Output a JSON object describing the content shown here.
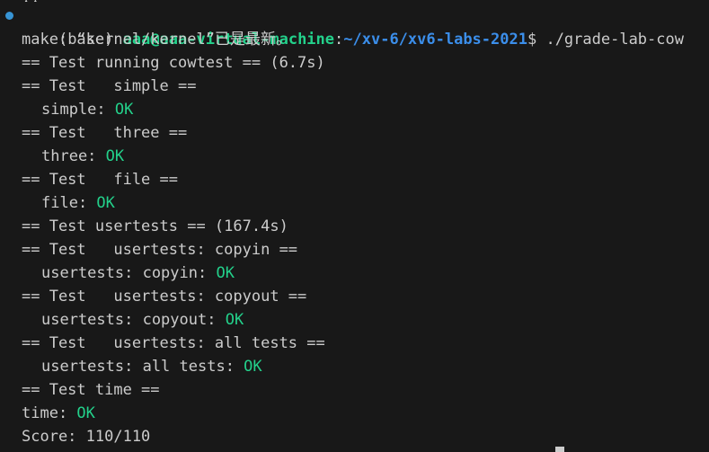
{
  "terminal": {
    "prompt": {
      "env": "(base) ",
      "user_host": "aaa@aaa-virtual-machine",
      "separator": ":",
      "path": "~/xv-6/xv6-labs-2021",
      "symbol": "$ ",
      "command": "./grade-lab-cow"
    },
    "lines": {
      "make": "make: “kernel/kernel”已是最新。",
      "cowtest_header": "== Test running cowtest == (6.7s)",
      "simple_header": "== Test   simple ==",
      "simple_label": "simple: ",
      "three_header": "== Test   three ==",
      "three_label": "three: ",
      "file_header": "== Test   file ==",
      "file_label": "file: ",
      "usertests_header": "== Test usertests == (167.4s)",
      "copyin_header": "== Test   usertests: copyin ==",
      "copyin_label": "usertests: copyin: ",
      "copyout_header": "== Test   usertests: copyout ==",
      "copyout_label": "usertests: copyout: ",
      "alltests_header": "== Test   usertests: all tests ==",
      "alltests_label": "usertests: all tests: ",
      "time_header": "== Test time ==",
      "time_label": "time: ",
      "score": "Score: 110/110"
    },
    "status": {
      "ok": "OK"
    }
  },
  "colors": {
    "background": "#181818",
    "text": "#cccccc",
    "ok": "#23d18b",
    "user_host": "#23d18b",
    "path": "#3b8eea",
    "prompt_dot": "#3794d4"
  }
}
